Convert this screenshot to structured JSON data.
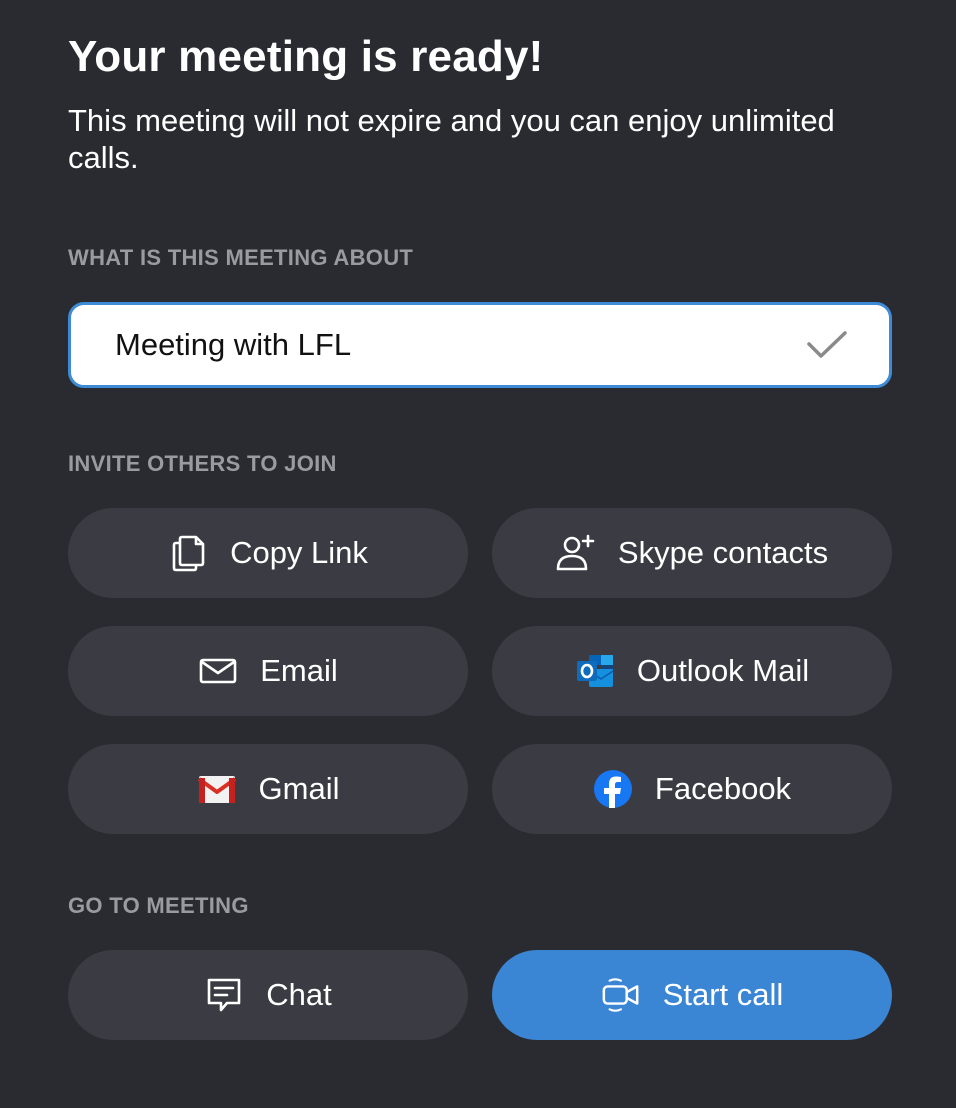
{
  "header": {
    "title": "Your meeting is ready!",
    "subtitle": "This meeting will not expire and you can enjoy unlimited calls."
  },
  "about": {
    "label": "WHAT IS THIS MEETING ABOUT",
    "value": "Meeting with LFL",
    "confirm_icon": "checkmark-icon"
  },
  "invite": {
    "label": "INVITE OTHERS TO JOIN",
    "copy_link": {
      "label": "Copy Link",
      "icon": "copy-icon"
    },
    "skype_contacts": {
      "label": "Skype contacts",
      "icon": "add-person-icon"
    },
    "email": {
      "label": "Email",
      "icon": "envelope-icon"
    },
    "outlook_mail": {
      "label": "Outlook Mail",
      "icon": "outlook-icon"
    },
    "gmail": {
      "label": "Gmail",
      "icon": "gmail-icon"
    },
    "facebook": {
      "label": "Facebook",
      "icon": "facebook-icon"
    }
  },
  "go": {
    "label": "GO TO MEETING",
    "chat": {
      "label": "Chat",
      "icon": "chat-icon"
    },
    "start_call": {
      "label": "Start call",
      "icon": "video-camera-icon"
    }
  },
  "colors": {
    "background": "#2a2b31",
    "button": "#3b3c43",
    "accent": "#3a86d4",
    "label_gray": "#9a9ba1"
  }
}
